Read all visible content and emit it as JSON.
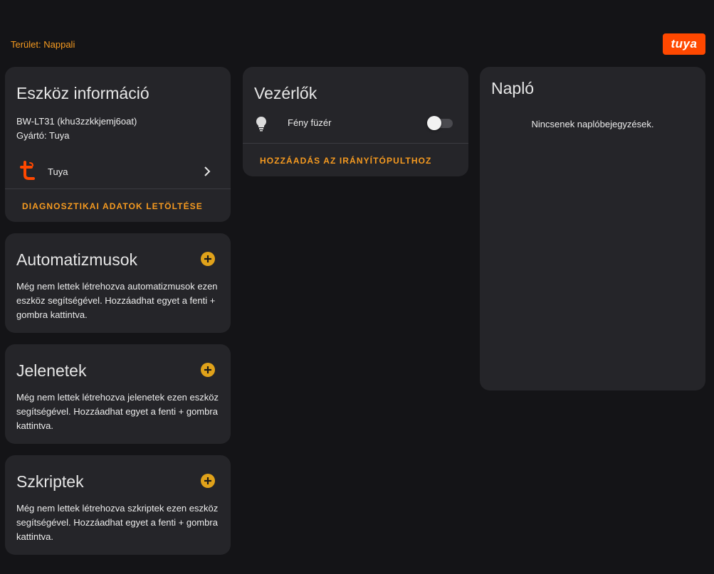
{
  "header": {
    "area_label": "Terület: Nappali",
    "brand_logo_text": "tuya"
  },
  "device_info": {
    "title": "Eszköz információ",
    "model": "BW-LT31 (khu3zzkkjemj6oat)",
    "manufacturer": "Gyártó: Tuya",
    "integration_label": "Tuya",
    "integration_icon": "tuya-icon",
    "download_diagnostics_label": "DIAGNOSZTIKAI ADATOK LETÖLTÉSE"
  },
  "automations": {
    "title": "Automatizmusok",
    "empty_text": "Még nem lettek létrehozva automatizmusok ezen eszköz segítségével. Hozzáadhat egyet a fenti + gombra kattintva."
  },
  "scenes": {
    "title": "Jelenetek",
    "empty_text": "Még nem lettek létrehozva jelenetek ezen eszköz segítségével. Hozzáadhat egyet a fenti + gombra kattintva."
  },
  "scripts": {
    "title": "Szkriptek",
    "empty_text": "Még nem lettek létrehozva szkriptek ezen eszköz segítségével. Hozzáadhat egyet a fenti + gombra kattintva."
  },
  "controls": {
    "title": "Vezérlők",
    "entities": [
      {
        "label": "Fény füzér",
        "icon": "lightbulb-icon",
        "state": "off"
      }
    ],
    "add_to_dashboard_label": "HOZZÁADÁS AZ IRÁNYÍTÓPULTHOZ"
  },
  "logbook": {
    "title": "Napló",
    "empty_text": "Nincsenek naplóbejegyzések."
  },
  "colors": {
    "background": "#141417",
    "card": "#252529",
    "accent": "#f59a20",
    "plus_button": "#e0a21a",
    "brand": "#ff4800"
  }
}
